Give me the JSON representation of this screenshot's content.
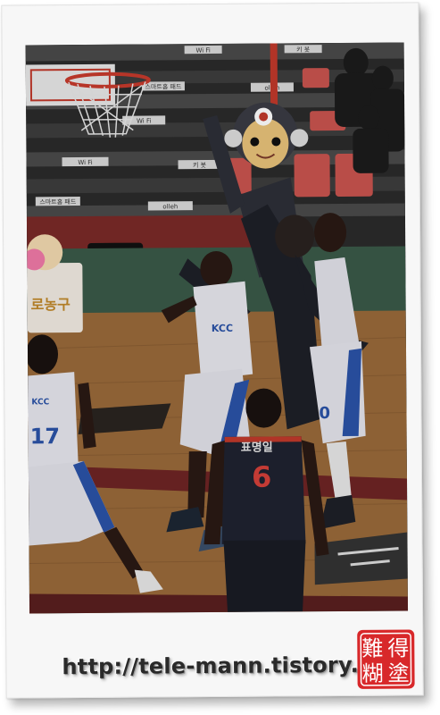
{
  "photo": {
    "scoreboard_ads": [
      "Wi Fi",
      "키 봇",
      "스마트홈 패드",
      "olleh",
      "Wi Fi",
      "키 봇",
      "스마트홈 패드",
      "olleh",
      "Wi Fi"
    ],
    "banner_text": "로농구",
    "player_blue_jersey_number": "17",
    "player_blue_name": "",
    "player_blue_team": "KCC",
    "player_dark_name": "표명일",
    "player_dark_number": "6"
  },
  "caption": {
    "url_text": "http://tele-mann.tistory.com"
  },
  "seal": {
    "characters": [
      "難",
      "得",
      "糊",
      "塗"
    ],
    "color": "#d8282a"
  }
}
